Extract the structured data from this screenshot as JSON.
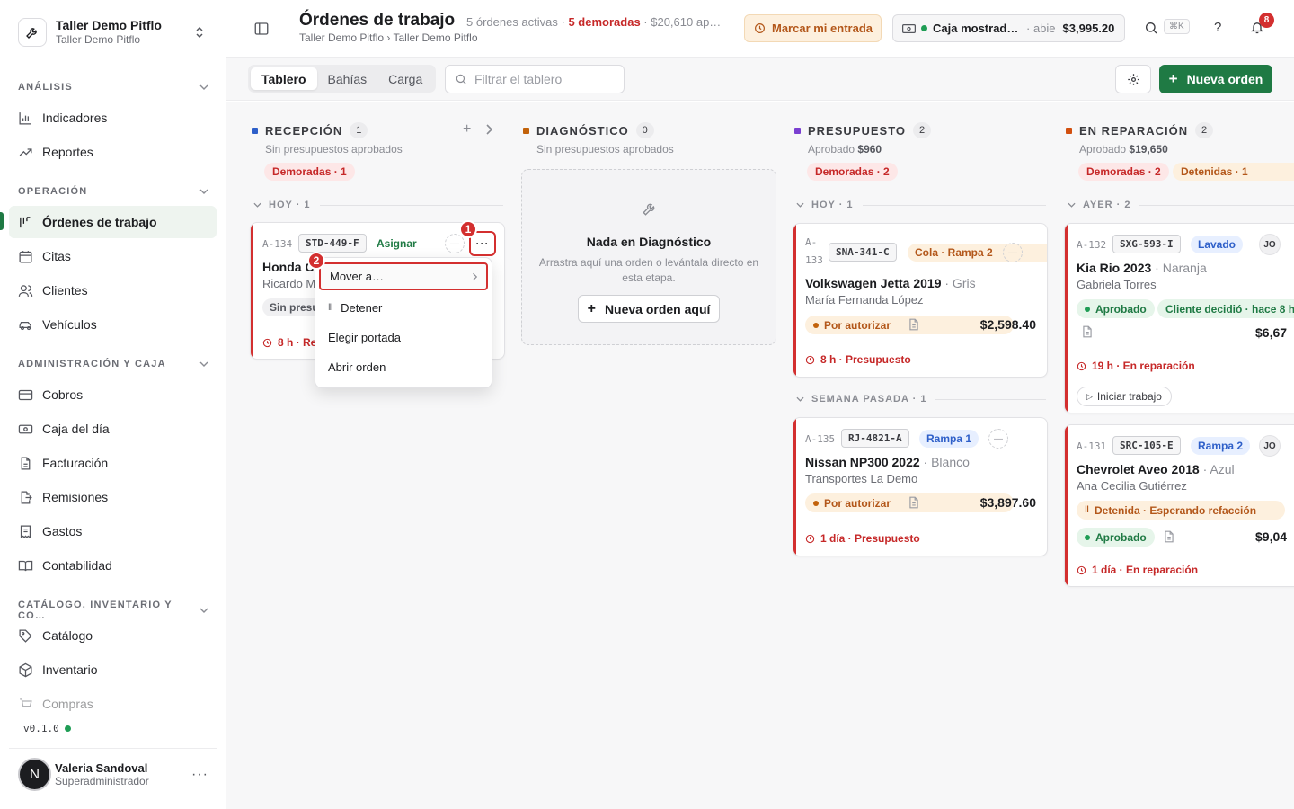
{
  "org": {
    "name": "Taller Demo Pitflo",
    "sub": "Taller Demo Pitflo"
  },
  "sidebar": {
    "sections": [
      {
        "label": "ANÁLISIS"
      },
      {
        "label": "OPERACIÓN"
      },
      {
        "label": "ADMINISTRACIÓN Y CAJA"
      },
      {
        "label": "CATÁLOGO, INVENTARIO Y CO…"
      }
    ],
    "items": [
      {
        "label": "Indicadores"
      },
      {
        "label": "Reportes"
      },
      {
        "label": "Órdenes de trabajo"
      },
      {
        "label": "Citas"
      },
      {
        "label": "Clientes"
      },
      {
        "label": "Vehículos"
      },
      {
        "label": "Cobros"
      },
      {
        "label": "Caja del día"
      },
      {
        "label": "Facturación"
      },
      {
        "label": "Remisiones"
      },
      {
        "label": "Gastos"
      },
      {
        "label": "Contabilidad"
      },
      {
        "label": "Catálogo"
      },
      {
        "label": "Inventario"
      },
      {
        "label": "Compras"
      }
    ],
    "version": "v0.1.0"
  },
  "user": {
    "initial": "N",
    "name": "Valeria Sandoval",
    "role": "Superadministrador"
  },
  "header": {
    "title": "Órdenes de trabajo",
    "meta_active": "5 órdenes activas ·",
    "meta_late": "5 demoradas",
    "meta_amount": "· $20,610 ap…",
    "breadcrumb": "Taller Demo Pitflo › Taller Demo Pitflo",
    "entrada_label": "Marcar mi entrada",
    "caja_name": "Caja mostrad…",
    "caja_status": "· abie",
    "caja_amount": "$3,995.20",
    "kbd": "⌘K",
    "help": "?",
    "notif_count": "8"
  },
  "toolbar": {
    "tabs": [
      "Tablero",
      "Bahías",
      "Carga"
    ],
    "filter_placeholder": "Filtrar el tablero",
    "new_order": "Nueva orden"
  },
  "columns": [
    {
      "name": "RECEPCIÓN",
      "count": "1",
      "sub": "Sin presupuestos aprobados",
      "color": "#2e5fc9",
      "pills": [
        "Demoradas · 1"
      ],
      "group": "HOY · 1"
    },
    {
      "name": "DIAGNÓSTICO",
      "count": "0",
      "sub": "Sin presupuestos aprobados",
      "color": "#c2620a"
    },
    {
      "name": "PRESUPUESTO",
      "count": "2",
      "sub_pre": "Aprobado",
      "sub_amt": "$960",
      "color": "#7a3fd1",
      "pills": [
        "Demoradas · 2"
      ],
      "groups": [
        "HOY · 1",
        "SEMANA PASADA · 1"
      ]
    },
    {
      "name": "EN REPARACIÓN",
      "count": "2",
      "sub_pre": "Aprobado",
      "sub_amt": "$19,650",
      "color": "#d2500f",
      "pills": [
        "Demoradas · 2",
        "Detenidas · 1"
      ],
      "group": "AYER · 2"
    }
  ],
  "empty": {
    "title": "Nada en Diagnóstico",
    "desc": "Arrastra aquí una orden o levántala directo en esta etapa.",
    "button": "Nueva orden aquí"
  },
  "cards": [
    {
      "code": "A-134",
      "plate": "STD-449-F",
      "assign": "Asignar",
      "vehicle": "Honda C",
      "client": "Ricardo M",
      "tag": "Sin presu",
      "foot": "8 h · Rec"
    },
    {
      "code": "A-",
      "code2": "133",
      "plate": "SNA-341-C",
      "tag": "Cola · Rampa 2",
      "vehicle": "Volkswagen Jetta 2019",
      "color": "· Gris",
      "client": "María Fernanda López",
      "status": "Por autorizar",
      "price": "$2,598.40",
      "foot": "8 h · Presupuesto"
    },
    {
      "code": "A-135",
      "plate": "RJ-4821-A",
      "tag": "Rampa 1",
      "vehicle": "Nissan NP300 2022",
      "color": "· Blanco",
      "client": "Transportes La Demo",
      "status": "Por autorizar",
      "price": "$3,897.60",
      "foot": "1 día · Presupuesto"
    },
    {
      "code": "A-132",
      "plate": "SXG-593-I",
      "tag": "Lavado",
      "jo": "JO",
      "vehicle": "Kia Rio 2023",
      "color": "· Naranja",
      "client": "Gabriela Torres",
      "status": "Aprobado",
      "status2": "Cliente decidió · hace 8 h",
      "price": "$6,67",
      "foot": "19 h · En reparación",
      "action": "Iniciar trabajo"
    },
    {
      "code": "A-131",
      "plate": "SRC-105-E",
      "tag": "Rampa 2",
      "jo": "JO",
      "vehicle": "Chevrolet Aveo 2018",
      "color": "· Azul",
      "client": "Ana Cecilia Gutiérrez",
      "detained": "Detenida · Esperando refacción",
      "status": "Aprobado",
      "price": "$9,04",
      "foot": "1 día · En reparación"
    }
  ],
  "menu": {
    "items": [
      "Mover a…",
      "Detener",
      "Elegir portada",
      "Abrir orden"
    ]
  },
  "markers": [
    "1",
    "2"
  ]
}
